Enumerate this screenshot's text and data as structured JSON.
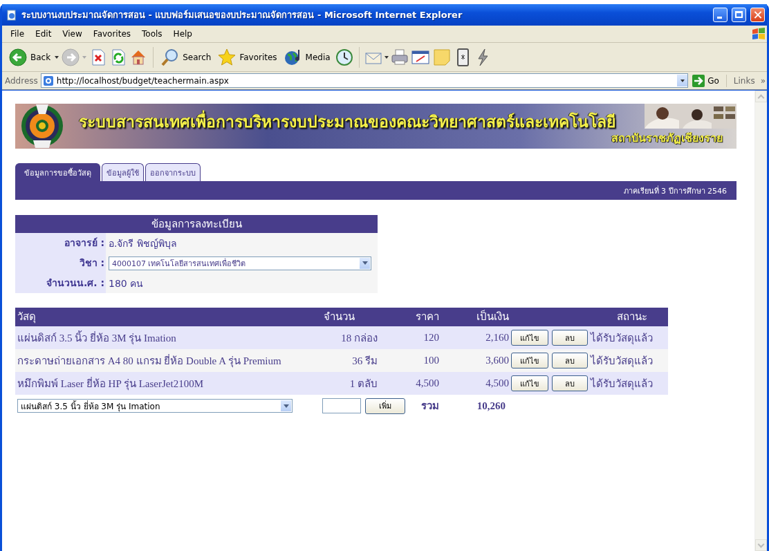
{
  "window": {
    "title": "ระบบงานงบประมาณจัดการสอน - แบบฟอร์มเสนอของบประมาณจัดการสอน - Microsoft Internet Explorer"
  },
  "menu": [
    "File",
    "Edit",
    "View",
    "Favorites",
    "Tools",
    "Help"
  ],
  "toolbar": [
    {
      "label": "Back"
    },
    {
      "label": "Search"
    },
    {
      "label": "Favorites"
    },
    {
      "label": "Media"
    }
  ],
  "address": {
    "label": "Address",
    "url": "http://localhost/budget/teachermain.aspx",
    "go": "Go",
    "links": "Links",
    "more": "»"
  },
  "page": {
    "banner": {
      "title": "ระบบสารสนเทศเพื่อการบริหารงบประมาณของคณะวิทยาศาสตร์และเทคโนโลยี",
      "subtitle": "สถาบันราชภัฏเชียงราย"
    },
    "tabs": [
      {
        "label": "ข้อมูลการขอซื้อวัสดุ",
        "selected": true
      },
      {
        "label": "ข้อมูลผู้ใช้",
        "selected": false
      },
      {
        "label": "ออกจากระบบ",
        "selected": false
      }
    ],
    "term": "ภาคเรียนที่ 3 ปีการศึกษา 2546",
    "registration": {
      "title": "ข้อมูลการลงทะเบียน",
      "fields": [
        {
          "kind": "text",
          "label": "อาจารย์ :",
          "value": "อ.จักรี พิชญ์พิบุล"
        },
        {
          "kind": "select",
          "label": "วิชา :",
          "value": "4000107 เทคโนโลยีสารสนเทศเพื่อชีวิต"
        },
        {
          "kind": "text",
          "label": "จำนวนน.ศ. :",
          "value": "180 คน"
        }
      ]
    },
    "items": {
      "columns": [
        "วัสดุ",
        "จำนวน",
        "ราคา",
        "เป็นเงิน",
        "สถานะ"
      ],
      "rows": [
        {
          "item": "แผ่นดิสก์ 3.5 นิ้ว ยี่ห้อ 3M รุ่น Imation",
          "quantity": "18 กล่อง",
          "price": "120",
          "amount": "2,160",
          "edit": "แก้ไข",
          "delete": "ลบ",
          "status": "ได้รับวัสดุแล้ว"
        },
        {
          "item": "กระดาษถ่ายเอกสาร A4 80 แกรม ยี่ห้อ Double A รุ่น Premium",
          "quantity": "36 รีม",
          "price": "100",
          "amount": "3,600",
          "edit": "แก้ไข",
          "delete": "ลบ",
          "status": "ได้รับวัสดุแล้ว"
        },
        {
          "item": "หมึกพิมพ์ Laser ยี่ห้อ HP รุ่น LaserJet2100M",
          "quantity": "1 ตลับ",
          "price": "4,500",
          "amount": "4,500",
          "edit": "แก้ไข",
          "delete": "ลบ",
          "status": "ได้รับวัสดุแล้ว"
        }
      ],
      "add": {
        "item": "แผ่นดิสก์ 3.5 นิ้ว ยี่ห้อ 3M รุ่น Imation",
        "button": "เพิ่ม",
        "total_label": "รวม",
        "total": "10,260"
      }
    }
  }
}
